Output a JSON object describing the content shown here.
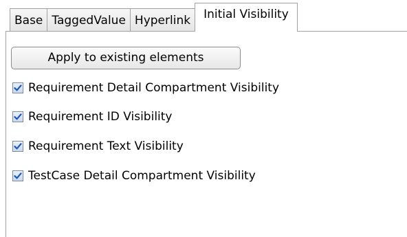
{
  "tabs": [
    {
      "label": "Base",
      "active": false
    },
    {
      "label": "TaggedValue",
      "active": false
    },
    {
      "label": "Hyperlink",
      "active": false
    },
    {
      "label": "Initial Visibility",
      "active": true
    }
  ],
  "panel": {
    "apply_button_label": "Apply to existing elements",
    "options": [
      {
        "label": "Requirement Detail Compartment Visibility",
        "checked": true
      },
      {
        "label": "Requirement ID Visibility",
        "checked": true
      },
      {
        "label": "Requirement Text Visibility",
        "checked": true
      },
      {
        "label": "TestCase Detail Compartment Visibility",
        "checked": true
      }
    ]
  },
  "colors": {
    "check_mark": "#1f57b8",
    "border": "#a0a0a0"
  }
}
